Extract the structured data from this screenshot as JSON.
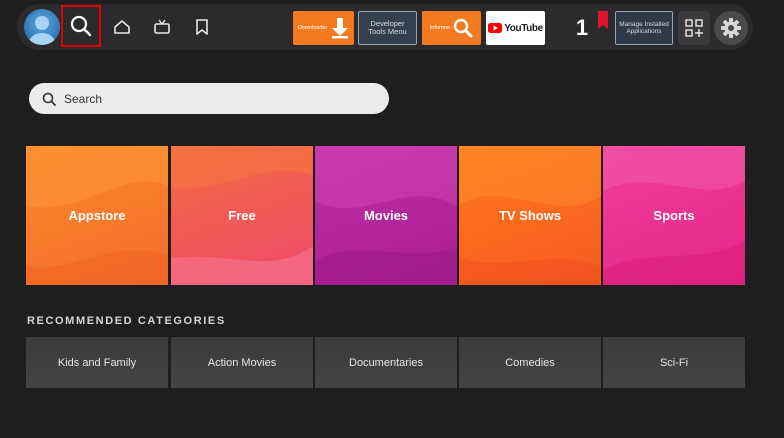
{
  "nav": {
    "icons": {
      "profile": "avatar-icon",
      "search": "search-icon",
      "home": "home-icon",
      "live": "tv-icon",
      "watchlist": "bookmark-icon",
      "apps": "apps-grid-icon",
      "settings": "gear-icon"
    },
    "apps": {
      "downloader": "Downloader",
      "developer_tools": "Developer Tools Menu",
      "informer": "Informer",
      "youtube": "YouTube",
      "one": "1",
      "manage": "Manage Installed Applications"
    }
  },
  "search": {
    "placeholder": "Search"
  },
  "categories": [
    "Appstore",
    "Free",
    "Movies",
    "TV Shows",
    "Sports"
  ],
  "recommended": {
    "title": "RECOMMENDED CATEGORIES",
    "items": [
      "Kids and Family",
      "Action Movies",
      "Documentaries",
      "Comedies",
      "Sci-Fi"
    ]
  },
  "colors": {
    "focus_border": "#e00000",
    "app_orange": "#f47a20",
    "youtube_red": "#ff0000"
  }
}
